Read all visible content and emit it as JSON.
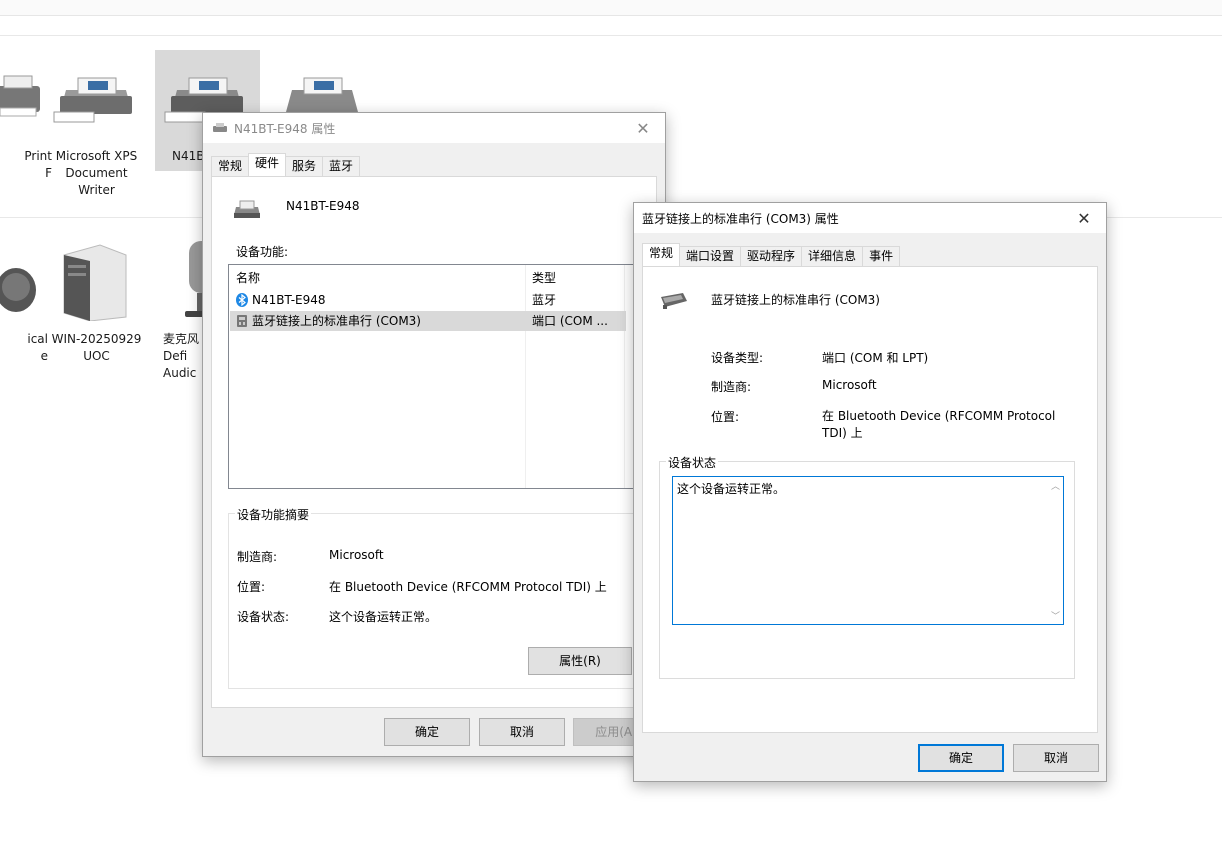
{
  "explorer": {
    "devices_row1": [
      {
        "label": "Print\nF"
      },
      {
        "label": "Microsoft XPS\nDocument\nWriter"
      },
      {
        "label": "N41B"
      },
      {
        "label": ""
      }
    ],
    "devices_row2": [
      {
        "label": "ical\ne"
      },
      {
        "label": "WIN-20250929\nUOC"
      },
      {
        "label": "麦克风\nDefi\nAudic"
      }
    ]
  },
  "props_window": {
    "title": "N41BT-E948 属性",
    "tabs": [
      "常规",
      "硬件",
      "服务",
      "蓝牙"
    ],
    "active_tab": "硬件",
    "device_name": "N41BT-E948",
    "functions_label": "设备功能:",
    "columns": [
      "名称",
      "类型"
    ],
    "rows": [
      {
        "name": "N41BT-E948",
        "type": "蓝牙"
      },
      {
        "name": "蓝牙链接上的标准串行 (COM3)",
        "type": "端口 (COM ..."
      }
    ],
    "summary_title": "设备功能摘要",
    "summary": [
      {
        "label": "制造商:",
        "value": "Microsoft"
      },
      {
        "label": "位置:",
        "value": "在 Bluetooth Device (RFCOMM Protocol TDI) 上"
      },
      {
        "label": "设备状态:",
        "value": "这个设备运转正常。"
      }
    ],
    "properties_button": "属性(R)",
    "ok": "确定",
    "cancel": "取消",
    "apply": "应用(A)"
  },
  "com_window": {
    "title": "蓝牙链接上的标准串行 (COM3) 属性",
    "tabs": [
      "常规",
      "端口设置",
      "驱动程序",
      "详细信息",
      "事件"
    ],
    "active_tab": "常规",
    "device_name": "蓝牙链接上的标准串行 (COM3)",
    "info": [
      {
        "label": "设备类型:",
        "value": "端口 (COM 和 LPT)"
      },
      {
        "label": "制造商:",
        "value": "Microsoft"
      },
      {
        "label": "位置:",
        "value": "在 Bluetooth Device (RFCOMM Protocol TDI) 上"
      }
    ],
    "status_group": "设备状态",
    "status_text": "这个设备运转正常。",
    "ok": "确定",
    "cancel": "取消"
  },
  "colors": {
    "accent": "#0078d7",
    "selection": "#d9d9d9",
    "dialog_bg": "#f0f0f0"
  }
}
